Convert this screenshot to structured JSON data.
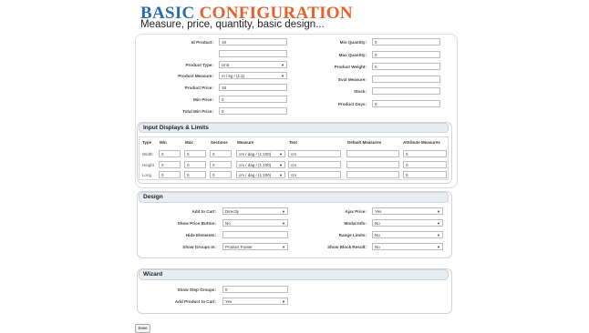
{
  "header": {
    "title_part1": "BASIC",
    "title_part2": "CONFIGURATION",
    "subtitle": "Measure, price, quantity, basic design..."
  },
  "basic": {
    "id_product_label": "Id Product:",
    "id_product_value": "18",
    "product_type_label": "Product Type:",
    "product_type_value": "Unit",
    "product_measure_label": "Product Measure:",
    "product_measure_value": "m / kg / (1:1)",
    "product_price_label": "Product Price:",
    "product_price_value": "18",
    "min_price_label": "Min Price:",
    "min_price_value": "0",
    "total_min_price_label": "Total Min Price:",
    "total_min_price_value": "0",
    "min_quantity_label": "Min Quantity:",
    "min_quantity_value": "0",
    "max_quantity_label": "Max Quantity:",
    "max_quantity_value": "0",
    "product_weight_label": "Product Weight:",
    "product_weight_value": "0",
    "eval_measure_label": "Eval Measure:",
    "eval_measure_value": "",
    "stock_label": "Stock:",
    "stock_value": "",
    "product_days_label": "Product Days:",
    "product_days_value": "0"
  },
  "input_limits": {
    "heading": "Input Displays & Limits",
    "columns": [
      "Type",
      "Min",
      "Max",
      "Sections",
      "Measure",
      "Text",
      "Default Measures",
      "Attribute Measures"
    ],
    "rows": [
      {
        "type": "Width",
        "min": "0",
        "max": "0",
        "sections": "0",
        "measure": "cm / dag / (1:100)",
        "text": "cm",
        "default": "",
        "attribute": "0"
      },
      {
        "type": "Height",
        "min": "0",
        "max": "0",
        "sections": "0",
        "measure": "cm / dag / (1:100)",
        "text": "cm",
        "default": "",
        "attribute": "0"
      },
      {
        "type": "Long",
        "min": "0",
        "max": "0",
        "sections": "0",
        "measure": "cm / dag / (1:100)",
        "text": "cm",
        "default": "",
        "attribute": "0"
      }
    ]
  },
  "design": {
    "heading": "Design",
    "add_to_cart_label": "Add to Cart:",
    "add_to_cart_value": "Directly",
    "show_price_button_label": "Show Price Button:",
    "show_price_button_value": "No",
    "hide_elements_label": "Hide Elements:",
    "hide_elements_value": "",
    "show_groups_in_label": "Show Groups In:",
    "show_groups_in_value": "Product Footer",
    "ajax_price_label": "Ajax Price:",
    "ajax_price_value": "Yes",
    "modal_info_label": "Modal Info:",
    "modal_info_value": "No",
    "range_limits_label": "Range Limits:",
    "range_limits_value": "No",
    "show_block_result_label": "Show Block Result:",
    "show_block_result_value": "No"
  },
  "wizard": {
    "heading": "Wizard",
    "show_step_groups_label": "Show Step Groups:",
    "show_step_groups_value": "0",
    "add_product_to_cart_label": "Add Product to Cart:",
    "add_product_to_cart_value": "Yes"
  },
  "footer": {
    "save_label": "Save"
  },
  "icons": {
    "dropdown": "chevron-down-icon"
  },
  "colors": {
    "title_blue": "#2b6cb0",
    "title_orange": "#e5602b",
    "panel_header_bg": "#e8edf2"
  }
}
